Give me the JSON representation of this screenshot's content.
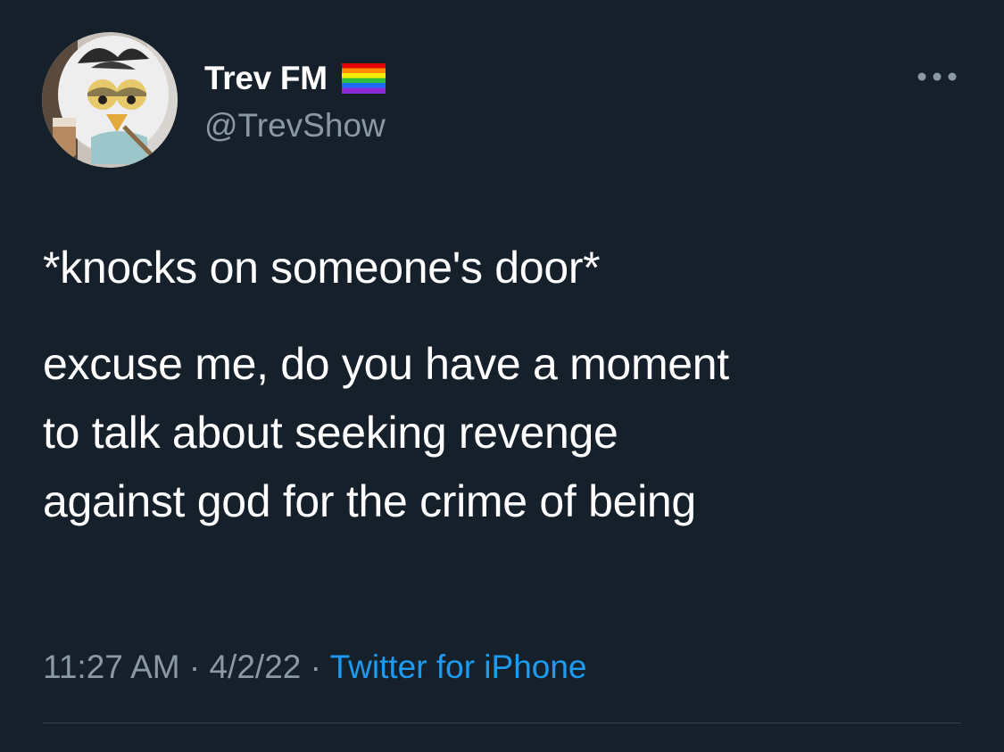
{
  "author": {
    "display_name": "Trev FM",
    "handle": "@TrevShow",
    "name_emoji": "rainbow-flag-icon",
    "avatar": "furby-avatar"
  },
  "menu": {
    "icon": "more-options-icon"
  },
  "tweet": {
    "paragraphs": [
      "*knocks on someone's door*",
      "excuse me, do you have a moment\nto talk about seeking revenge\nagainst god for the crime of being"
    ]
  },
  "meta": {
    "time": "11:27 AM",
    "date": "4/2/22",
    "separator": "·",
    "source": "Twitter for iPhone"
  },
  "colors": {
    "background": "#15202b",
    "text": "#ffffff",
    "secondary_text": "#8b98a5",
    "link": "#1d9bf0",
    "divider": "#38444d"
  }
}
